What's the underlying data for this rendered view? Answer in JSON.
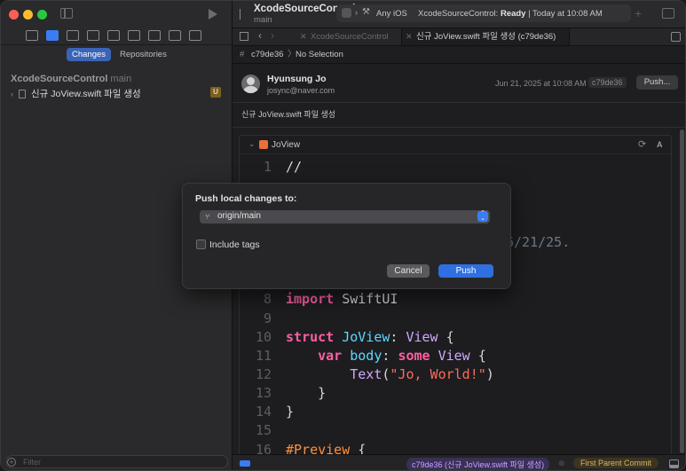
{
  "sidebar": {
    "tabs": [
      "Changes",
      "Repositories"
    ],
    "repo_name": "XcodeSourceControl",
    "repo_branch": "main",
    "commit_row_label": "신규 JoView.swift 파일 생성",
    "commit_badge": "U",
    "filter_placeholder": "Filter"
  },
  "toolbar": {
    "project_title": "XcodeSourceControl",
    "project_branch": "main",
    "scheme_destination": "Any iOS",
    "status_prefix": "XcodeSourceControl: ",
    "status_bold": "Ready",
    "status_suffix": " | Today at 10:08 AM"
  },
  "tabs": [
    {
      "label": "XcodeSourceControl"
    },
    {
      "label": "신규 JoView.swift 파일 생성 (c79de36)"
    }
  ],
  "breadcrumb": {
    "commit": "c79de36",
    "separator": "〉",
    "selection": "No Selection"
  },
  "commit": {
    "author": "Hyunsung Jo",
    "email": "josync@naver.com",
    "date": "Jun 21, 2025 at 10:08 AM",
    "hash": "c79de36",
    "push_label": "Push...",
    "message": "신규 JoView.swift 파일 생성"
  },
  "file": {
    "name": "JoView",
    "badge": "A",
    "lines": [
      {
        "n": "1",
        "text": "//"
      },
      {
        "n": "7",
        "text": "6/21/25."
      },
      {
        "n": "8",
        "text": "import SwiftUI"
      },
      {
        "n": "9",
        "text": ""
      },
      {
        "n": "10",
        "text": "struct JoView: View {"
      },
      {
        "n": "11",
        "text": "    var body: some View {"
      },
      {
        "n": "12",
        "text": "        Text(\"Jo, World!\")"
      },
      {
        "n": "13",
        "text": "    }"
      },
      {
        "n": "14",
        "text": "}"
      },
      {
        "n": "15",
        "text": ""
      },
      {
        "n": "16",
        "text": "#Preview {"
      }
    ]
  },
  "bottom_bar": {
    "commit_label": "c79de36 (신규 JoView.swift 파일 생성)",
    "parent_label": "First Parent Commit"
  },
  "push_sheet": {
    "title": "Push local changes to:",
    "remote_value": "origin/main",
    "include_tags_label": "Include tags",
    "include_tags_checked": false,
    "cancel_label": "Cancel",
    "push_label": "Push"
  },
  "colors": {
    "accent": "#2f6fe0",
    "keyword": "#fc5fa3",
    "type": "#5dd8ff",
    "string": "#fc6a5d",
    "badge_untracked": "#7c6020"
  },
  "icons": [
    "folder-icon",
    "source-control-icon",
    "bookmark-icon",
    "search-icon",
    "warning-icon",
    "test-icon",
    "debug-icon",
    "breakpoint-icon",
    "report-icon"
  ]
}
